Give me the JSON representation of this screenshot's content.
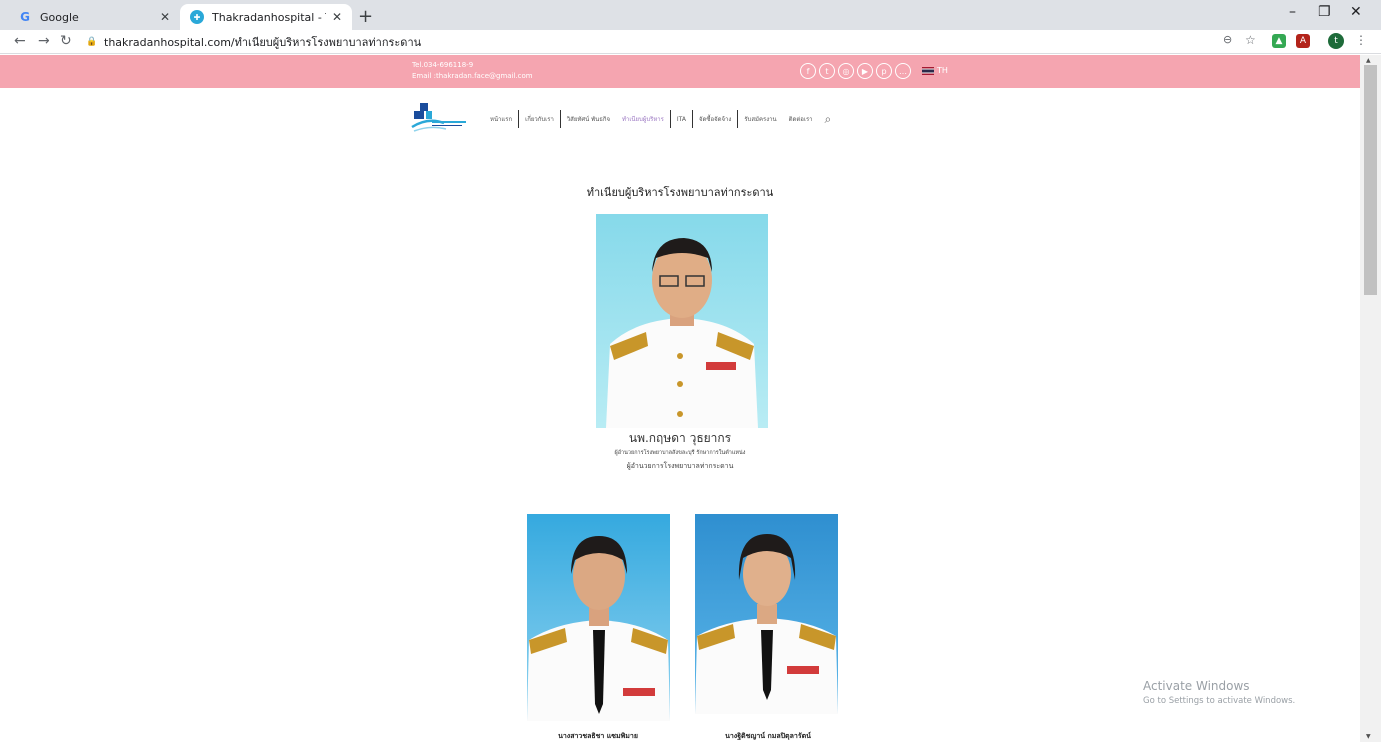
{
  "browser": {
    "tabs": [
      {
        "title": "Google",
        "favicon": "google-g-icon"
      },
      {
        "title": "Thakradanhospital - Thakradanh",
        "favicon": "site-favicon-icon"
      }
    ],
    "url": "thakradanhospital.com/ทำเนียบผู้บริหารโรงพยาบาลท่ากระดาน",
    "profile_initial": "t"
  },
  "site": {
    "tel": "Tel.034-696118-9",
    "email": "Email :thakradan.face@gmail.com",
    "lang": "TH",
    "socials": [
      "facebook-icon",
      "twitter-icon",
      "instagram-icon",
      "youtube-icon",
      "pinterest-icon",
      "line-icon"
    ],
    "nav": [
      {
        "label": "หน้าแรก"
      },
      {
        "label": "เกี่ยวกับเรา"
      },
      {
        "label": "วิสัยทัศน์ พันธกิจ"
      },
      {
        "label": "ทำเนียบผู้บริหาร",
        "active": true
      },
      {
        "label": "ITA"
      },
      {
        "label": "จัดซื้อจัดจ้าง"
      },
      {
        "label": "รับสมัครงาน"
      },
      {
        "label": "ติดต่อเรา"
      }
    ]
  },
  "main": {
    "title": "ทำเนียบผู้บริหารโรงพยาบาลท่ากระดาน",
    "director": {
      "name": "นพ.กฤษดา วุธยากร",
      "note": "ผู้อำนวยการโรงพยาบาลสังขละบุรี รักษาการในตำแหน่ง",
      "position": "ผู้อำนวยการโรงพยาบาลท่ากระดาน"
    },
    "deputies": [
      {
        "name": "นางสาวชลธิชา แซมพิมาย"
      },
      {
        "name": "นางฐิติชญาน์ กมลปิตุลารัตน์"
      }
    ]
  },
  "os_watermark": {
    "line1": "Activate Windows",
    "line2": "Go to Settings to activate Windows."
  },
  "colors": {
    "topbar": "#f5a5b0",
    "nav_active": "#9b77c2"
  }
}
